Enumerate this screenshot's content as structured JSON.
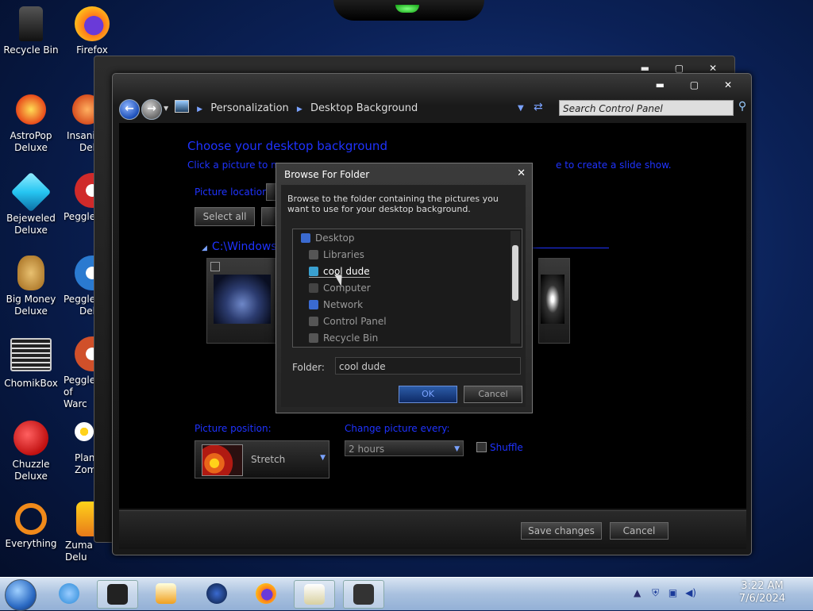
{
  "desktop_icons": [
    {
      "label": "Recycle Bin",
      "color": "#222"
    },
    {
      "label": "Firefox",
      "color": "#ff6b1a"
    },
    {
      "label": "AstroPop Deluxe",
      "color": "#e84a1a"
    },
    {
      "label": "Insaniquarium Deluxe",
      "color": "#d85020"
    },
    {
      "label": "Bejeweled Deluxe",
      "color": "#26c6f2"
    },
    {
      "label": "Peggle",
      "color": "#d02a2a"
    },
    {
      "label": "Big Money Deluxe",
      "color": "#c8902a"
    },
    {
      "label": "Peggle Deluxe",
      "color": "#2a7ad0"
    },
    {
      "label": "ChomikBox",
      "color": "#3a3a3a"
    },
    {
      "label": "Peggle of Wario",
      "color": "#d0502a"
    },
    {
      "label": "Chuzzle Deluxe",
      "color": "#d02020"
    },
    {
      "label": "Plants vs Zombies",
      "color": "#f0f0f0"
    },
    {
      "label": "Everything",
      "color": "#f08a1a"
    },
    {
      "label": "Zuma Deluxe",
      "color": "#f0a01a"
    }
  ],
  "desktop_icons_visible": {
    "recycle_bin": "Recycle Bin",
    "firefox": "Firefox",
    "astropop_1": "AstroPop",
    "astropop_2": "Deluxe",
    "insani_1": "Insanic",
    "insani_2": "Delu",
    "bejeweled_1": "Bejeweled",
    "bejeweled_2": "Deluxe",
    "peggle_a": "Peggle",
    "bigmoney_1": "Big Money",
    "bigmoney_2": "Deluxe",
    "peggle_b1": "Peggle",
    "peggle_b2": "Delu",
    "chomikbox": "ChomikBox",
    "peggle_c1": "Peggle",
    "peggle_c2": "of Warc",
    "chuzzle_1": "Chuzzle",
    "chuzzle_2": "Deluxe",
    "plants_1": "Plant",
    "plants_2": "Zom",
    "everything": "Everything",
    "zuma": "Zuma Delu"
  },
  "window": {
    "caption_buttons": "▬ ▢ ✕",
    "breadcrumb": [
      "Personalization",
      "Desktop Background"
    ],
    "search_placeholder": "Search Control Panel",
    "heading": "Choose your desktop background",
    "instruction_left": "Click a picture to m",
    "instruction_right": "e to create a slide show.",
    "picture_location_label": "Picture location:",
    "select_all": "Select all",
    "path": "C:\\Windows",
    "picture_position_label": "Picture position:",
    "position_value": "Stretch",
    "change_every_label": "Change picture every:",
    "change_every_value": "2 hours",
    "shuffle_label": "Shuffle",
    "save_changes": "Save changes",
    "cancel": "Cancel"
  },
  "dialog": {
    "title": "Browse For Folder",
    "close": "✕",
    "description": "Browse to the folder containing the pictures you want to use for your desktop background.",
    "tree": [
      {
        "label": "Desktop",
        "color": "#3a6ad0",
        "selected": false
      },
      {
        "label": "Libraries",
        "color": "#555",
        "selected": false
      },
      {
        "label": "cool dude",
        "color": "#3aa0d0",
        "selected": true
      },
      {
        "label": "Computer",
        "color": "#444",
        "selected": false
      },
      {
        "label": "Network",
        "color": "#3a6ad0",
        "selected": false
      },
      {
        "label": "Control Panel",
        "color": "#555",
        "selected": false
      },
      {
        "label": "Recycle Bin",
        "color": "#555",
        "selected": false
      }
    ],
    "folder_label": "Folder:",
    "folder_value": "cool dude",
    "ok": "OK",
    "cancel": "Cancel"
  },
  "taskbar": {
    "time": "3:22 AM",
    "date": "7/6/2024",
    "items": [
      {
        "name": "ie-icon",
        "color": "#2a8ad8",
        "active": false
      },
      {
        "name": "explorer-window-icon",
        "color": "#222",
        "active": true
      },
      {
        "name": "media-player-icon",
        "color": "#f0a020",
        "active": false
      },
      {
        "name": "globe-app-icon",
        "color": "#123",
        "active": false
      },
      {
        "name": "firefox-icon",
        "color": "#ff6b1a",
        "active": false
      },
      {
        "name": "paint-icon",
        "color": "#d8d0a0",
        "active": true
      },
      {
        "name": "control-panel-icon",
        "color": "#333",
        "active": true
      }
    ]
  }
}
